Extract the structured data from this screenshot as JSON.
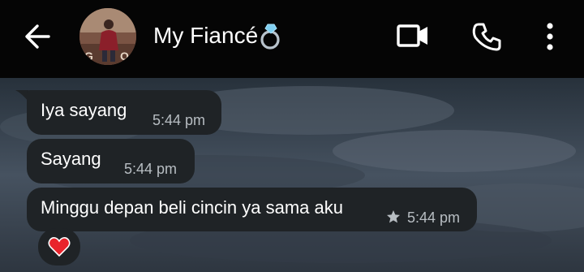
{
  "header": {
    "contact_name": "My Fiancé",
    "back_icon": "arrow-left-icon",
    "video_icon": "video-call-icon",
    "phone_icon": "phone-call-icon",
    "more_icon": "more-vertical-icon",
    "ring_icon": "ring-emoji-icon"
  },
  "messages": [
    {
      "text": "Iya sayang",
      "time": "5:44 pm",
      "starred": false
    },
    {
      "text": "Sayang",
      "time": "5:44 pm",
      "starred": false
    },
    {
      "text": "Minggu depan beli cincin ya sama aku",
      "time": "5:44 pm",
      "starred": true
    }
  ],
  "reaction": {
    "icon": "red-heart-emoji-icon"
  },
  "colors": {
    "header_bg": "#050505",
    "bubble_bg": "#1f2326",
    "text": "#ffffff",
    "time_text": "#b7bdc2"
  }
}
